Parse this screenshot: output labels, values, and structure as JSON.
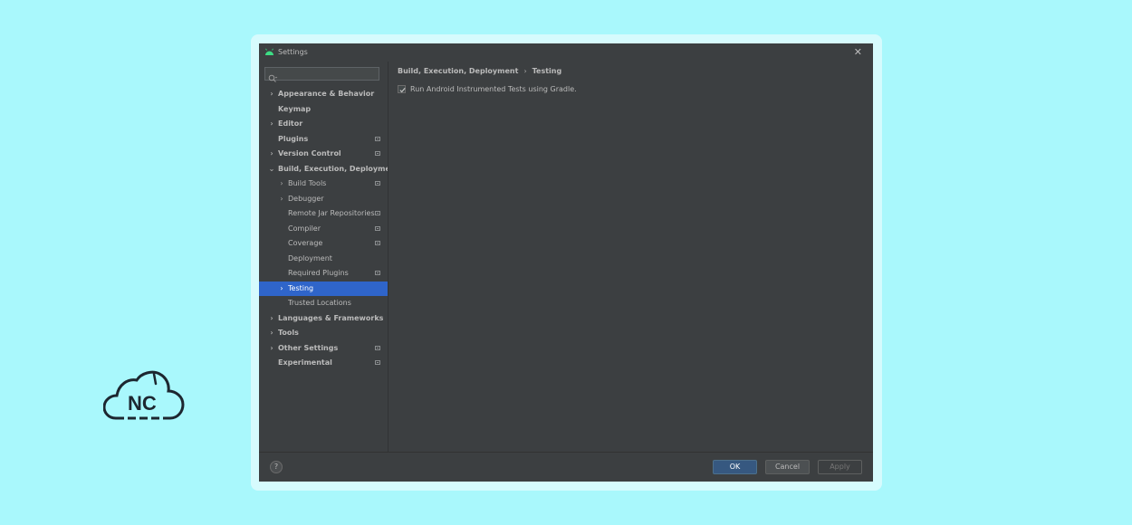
{
  "window": {
    "title": "Settings",
    "close_glyph": "✕",
    "icon": "android-logo-icon",
    "accent_color": "#2f65ca",
    "background_color": "#3c3f41"
  },
  "search": {
    "placeholder": "",
    "value": ""
  },
  "tree": {
    "appearance": "Appearance & Behavior",
    "keymap": "Keymap",
    "editor": "Editor",
    "plugins": "Plugins",
    "version_control": "Version Control",
    "build": "Build, Execution, Deployment",
    "build_tools": "Build Tools",
    "debugger": "Debugger",
    "remote_jar": "Remote Jar Repositories",
    "compiler": "Compiler",
    "coverage": "Coverage",
    "deployment": "Deployment",
    "required_plugins": "Required Plugins",
    "testing": "Testing",
    "trusted_locations": "Trusted Locations",
    "languages": "Languages & Frameworks",
    "tools": "Tools",
    "other_settings": "Other Settings",
    "experimental": "Experimental"
  },
  "breadcrumb": {
    "parent": "Build, Execution, Deployment",
    "separator": "›",
    "current": "Testing"
  },
  "options": {
    "run_instrumented_label": "Run Android Instrumented Tests using Gradle.",
    "run_instrumented_checked": true
  },
  "footer": {
    "help": "?",
    "ok": "OK",
    "cancel": "Cancel",
    "apply": "Apply"
  },
  "brand": {
    "logo_text": "NC",
    "icon": "cloud-logo-icon"
  },
  "page_background_color": "#a9f8fc"
}
